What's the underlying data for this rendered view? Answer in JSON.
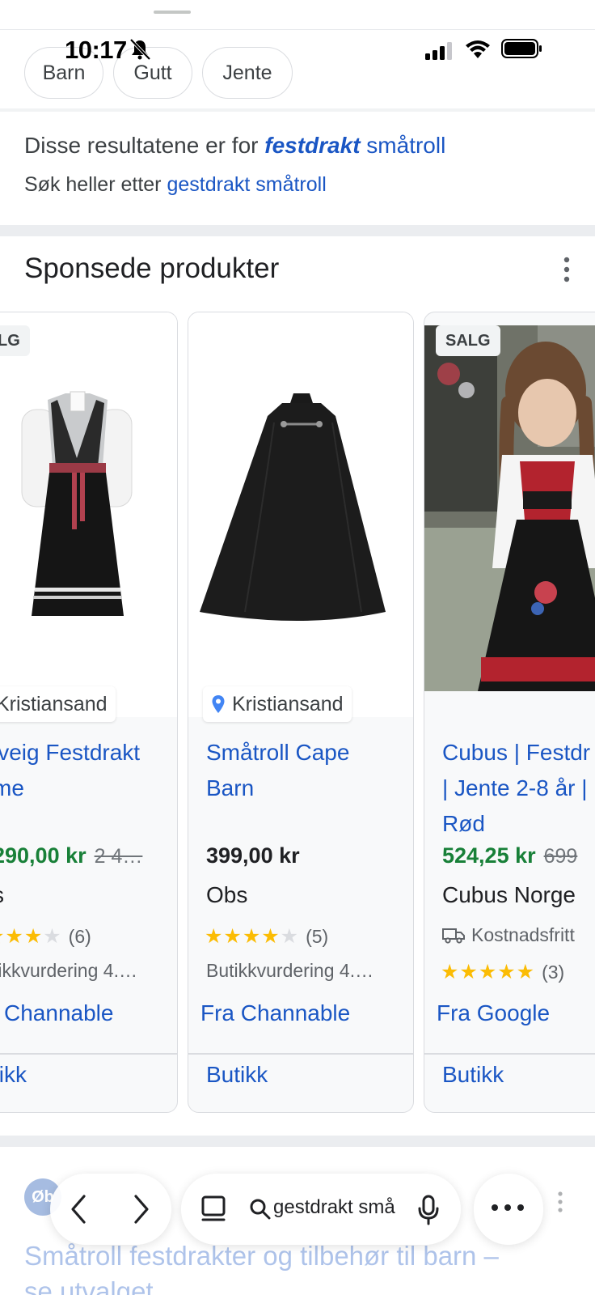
{
  "status_bar": {
    "time": "10:17"
  },
  "chips": [
    {
      "label": "Barn"
    },
    {
      "label": "Gutt"
    },
    {
      "label": "Jente"
    }
  ],
  "spelling": {
    "prefix": "Disse resultatene er for",
    "corrected_emphasis": "festdrakt",
    "corrected_rest": "småtroll",
    "alt_prefix": "Søk heller etter",
    "alt_query": "gestdrakt småtroll"
  },
  "sponsored": {
    "title": "Sponsede produkter",
    "products": [
      {
        "badge": "LG",
        "location": "Kristiansand",
        "title_line1": "lveig Festdrakt",
        "title_line2": "me",
        "price": "290,00 kr",
        "old_price": "2 4…",
        "merchant": "s",
        "review_count": "(6)",
        "shop_rating": "tikkvurdering 4.…",
        "source": "Channable",
        "shop_label": "tikk"
      },
      {
        "location": "Kristiansand",
        "title_line1": "Småtroll Cape",
        "title_line2": "Barn",
        "price": "399,00 kr",
        "merchant": "Obs",
        "review_count": "(5)",
        "shop_rating": "Butikkvurdering 4.…",
        "source": "Fra Channable",
        "shop_label": "Butikk"
      },
      {
        "badge": "SALG",
        "title_line1": "Cubus | Festdr",
        "title_line2": "| Jente 2-8 år |",
        "title_line3": "Rød",
        "price": "524,25 kr",
        "old_price": "699",
        "merchant": "Cubus Norge",
        "shipping": "Kostnadsfritt",
        "review_count": "(3)",
        "source": "Fra Google",
        "shop_label": "Butikk"
      }
    ]
  },
  "next_result": {
    "favicon_text": "Øb",
    "title": "Småtroll festdrakter og tilbehør til barn –",
    "title_line2": "se utvalget"
  },
  "browser_bar": {
    "url_text": "gestdrakt små"
  },
  "colors": {
    "link": "#1a56c4",
    "sale_price": "#188038",
    "stars": "#fbbc04"
  }
}
